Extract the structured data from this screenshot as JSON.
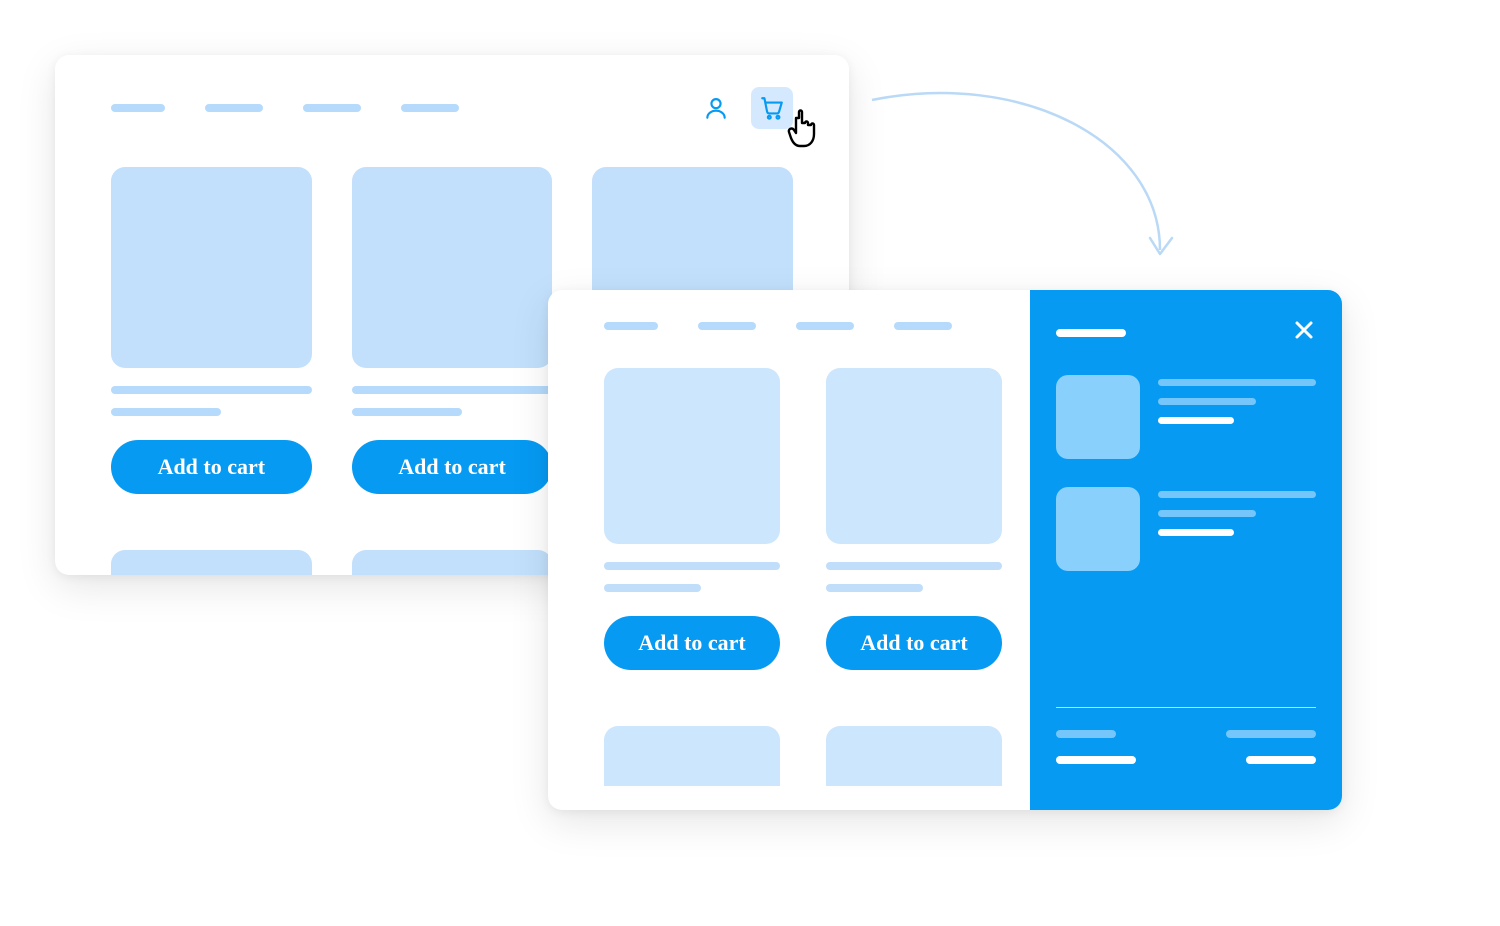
{
  "buttons": {
    "add_to_cart": "Add to cart"
  },
  "icons": {
    "user": "user-icon",
    "cart": "cart-icon",
    "close": "close-icon",
    "cursor": "pointer-cursor-icon"
  },
  "colors": {
    "accent": "#069af3",
    "placeholder_light": "#b5dafc",
    "placeholder_thumb": "#c2e0fc"
  },
  "diagram": {
    "description": "Clicking the cart icon opens a slide-out cart panel",
    "screens": [
      "product-listing",
      "product-listing-with-cart-panel"
    ]
  }
}
